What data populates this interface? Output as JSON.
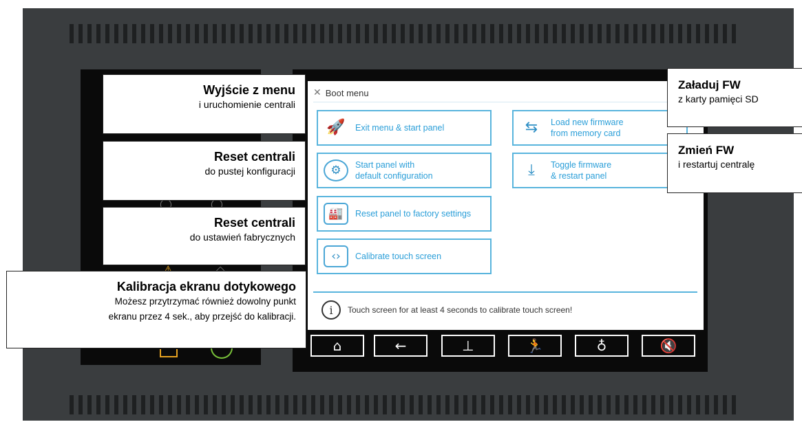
{
  "boot_menu": {
    "title": "Boot menu",
    "buttons": {
      "exit": {
        "label": "Exit menu & start panel",
        "icon": "rocket-icon"
      },
      "default_config": {
        "label_line1": "Start panel with",
        "label_line2": "default configuration",
        "icon": "gear-reset-icon"
      },
      "factory": {
        "label": "Reset panel to factory settings",
        "icon": "factory-icon"
      },
      "calibrate": {
        "label": "Calibrate touch screen",
        "icon": "monitor-icon"
      },
      "load_fw": {
        "label_line1": "Load new firmware",
        "label_line2": "from memory card",
        "icon": "swap-icon"
      },
      "toggle_fw": {
        "label_line1": "Toggle firmware",
        "label_line2": "& restart panel",
        "icon": "download-icon"
      }
    },
    "info_text": "Touch screen for at least 4 seconds to calibrate touch screen!",
    "navbar": [
      "home-icon",
      "back-arrow-icon",
      "hierarchy-icon",
      "evacuation-icon",
      "user-icon",
      "mute-icon"
    ]
  },
  "callouts": {
    "exit": {
      "title": "Wyjście z menu",
      "sub": "i uruchomienie centrali"
    },
    "reset_empty": {
      "title": "Reset centrali",
      "sub": "do pustej konfiguracji"
    },
    "reset_factory": {
      "title": "Reset centrali",
      "sub": "do ustawień fabrycznych"
    },
    "calibration": {
      "title": "Kalibracja ekranu dotykowego",
      "sub1": "Możesz przytrzymać również dowolny punkt",
      "sub2": "ekranu przez 4 sek., aby przejść do kalibracji."
    },
    "load_fw": {
      "title": "Załaduj FW",
      "sub": "z karty pamięci SD"
    },
    "change_fw": {
      "title": "Zmień FW",
      "sub": "i restartuj centralę"
    }
  },
  "colors": {
    "accent": "#2a9ed8",
    "button_border": "#58b4dd",
    "housing": "#3a3d3f",
    "screen_bezel": "#0a0a0a"
  }
}
